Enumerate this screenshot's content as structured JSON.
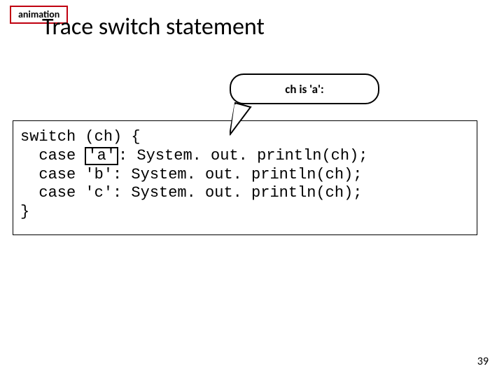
{
  "tag": {
    "label": "animation"
  },
  "title": "Trace switch statement",
  "callout": "ch is 'a':",
  "code": {
    "l1a": "switch (ch) {",
    "l2a": "  case ",
    "l2hl": "'a'",
    "l2b": ": System. out. println(ch);",
    "l3": "  case 'b': System. out. println(ch);",
    "l4": "  case 'c': System. out. println(ch);",
    "l5": "}"
  },
  "page": "39"
}
